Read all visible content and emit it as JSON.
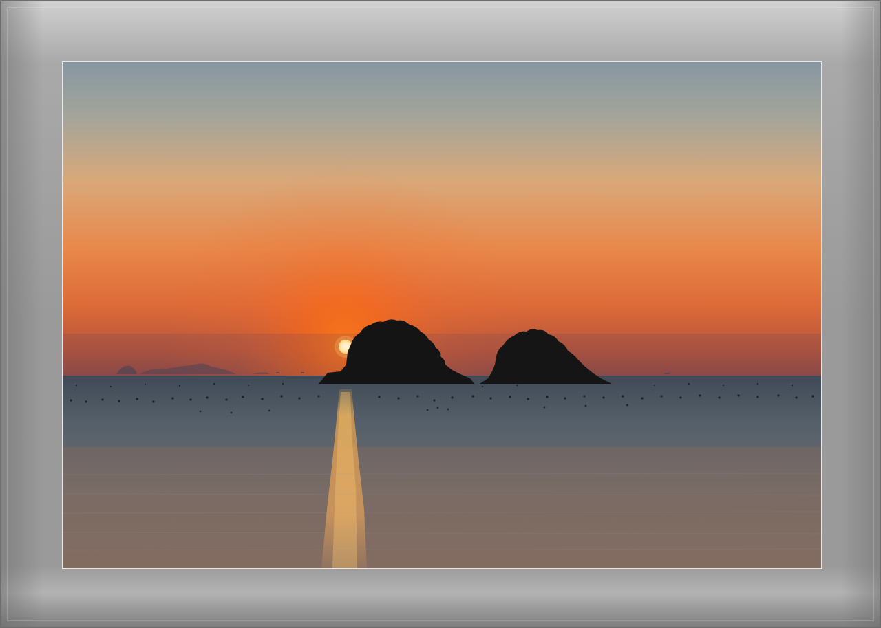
{
  "scene": {
    "description_tag": "sunset-over-sea-with-two-islets",
    "colors": {
      "frame_gray": "#9a9a9a",
      "sky_top": "#8898a2",
      "sky_mid": "#dda877",
      "sky_horizon": "#e6641e",
      "sun": "#fff4d2",
      "sea": "#5b6166",
      "island_silhouette": "#141414"
    }
  }
}
